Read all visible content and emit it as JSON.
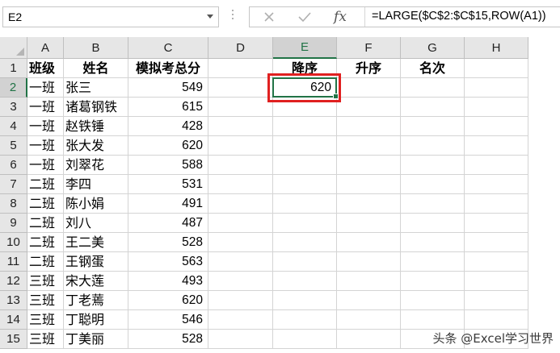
{
  "formula_bar": {
    "name_box": "E2",
    "formula": "=LARGE($C$2:$C$15,ROW(A1))",
    "fx_label": "fx"
  },
  "columns": [
    "A",
    "B",
    "C",
    "D",
    "E",
    "F",
    "G",
    "H"
  ],
  "rows": [
    "1",
    "2",
    "3",
    "4",
    "5",
    "6",
    "7",
    "8",
    "9",
    "10",
    "11",
    "12",
    "13",
    "14",
    "15"
  ],
  "headers": {
    "class": "班级",
    "name": "姓名",
    "score": "模拟考总分",
    "desc": "降序",
    "asc": "升序",
    "rank": "名次"
  },
  "data": [
    {
      "class": "一班",
      "name": "张三",
      "score": "549"
    },
    {
      "class": "一班",
      "name": "诸葛钢铁",
      "score": "615"
    },
    {
      "class": "一班",
      "name": "赵铁锤",
      "score": "428"
    },
    {
      "class": "一班",
      "name": "张大发",
      "score": "620"
    },
    {
      "class": "一班",
      "name": "刘翠花",
      "score": "588"
    },
    {
      "class": "二班",
      "name": "李四",
      "score": "531"
    },
    {
      "class": "二班",
      "name": "陈小娟",
      "score": "491"
    },
    {
      "class": "二班",
      "name": "刘八",
      "score": "487"
    },
    {
      "class": "二班",
      "name": "王二美",
      "score": "528"
    },
    {
      "class": "二班",
      "name": "王钢蛋",
      "score": "563"
    },
    {
      "class": "三班",
      "name": "宋大莲",
      "score": "493"
    },
    {
      "class": "三班",
      "name": "丁老蔫",
      "score": "620"
    },
    {
      "class": "三班",
      "name": "丁聪明",
      "score": "546"
    },
    {
      "class": "三班",
      "name": "丁美丽",
      "score": "528"
    }
  ],
  "e2_value": "620",
  "watermark": "头条 @Excel学习世界",
  "colors": {
    "selection": "#217346",
    "highlight_box": "#e02020",
    "header_bg": "#e6e6e6"
  }
}
